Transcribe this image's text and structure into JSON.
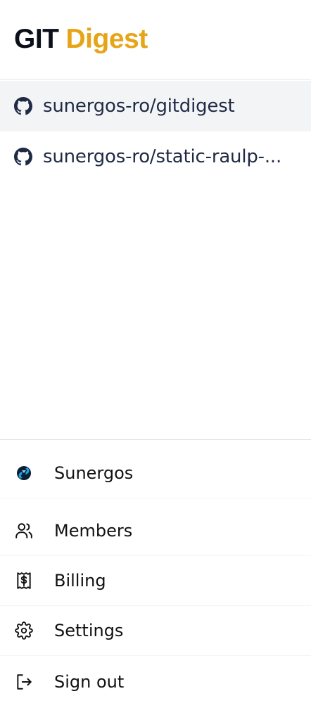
{
  "brand": {
    "part1": "GIT",
    "part2": "Digest",
    "accent_color": "#e6a417"
  },
  "repos": [
    {
      "label": "sunergos-ro/gitdigest",
      "icon": "github-icon",
      "active": true
    },
    {
      "label": "sunergos-ro/static-raulp-...",
      "icon": "github-icon",
      "active": false
    }
  ],
  "menu": {
    "org": {
      "label": "Sunergos",
      "icon": "sunergos-logo-icon"
    },
    "members": {
      "label": "Members",
      "icon": "users-icon"
    },
    "billing": {
      "label": "Billing",
      "icon": "receipt-dollar-icon"
    },
    "settings": {
      "label": "Settings",
      "icon": "gear-icon"
    },
    "signout": {
      "label": "Sign out",
      "icon": "sign-out-icon"
    }
  }
}
